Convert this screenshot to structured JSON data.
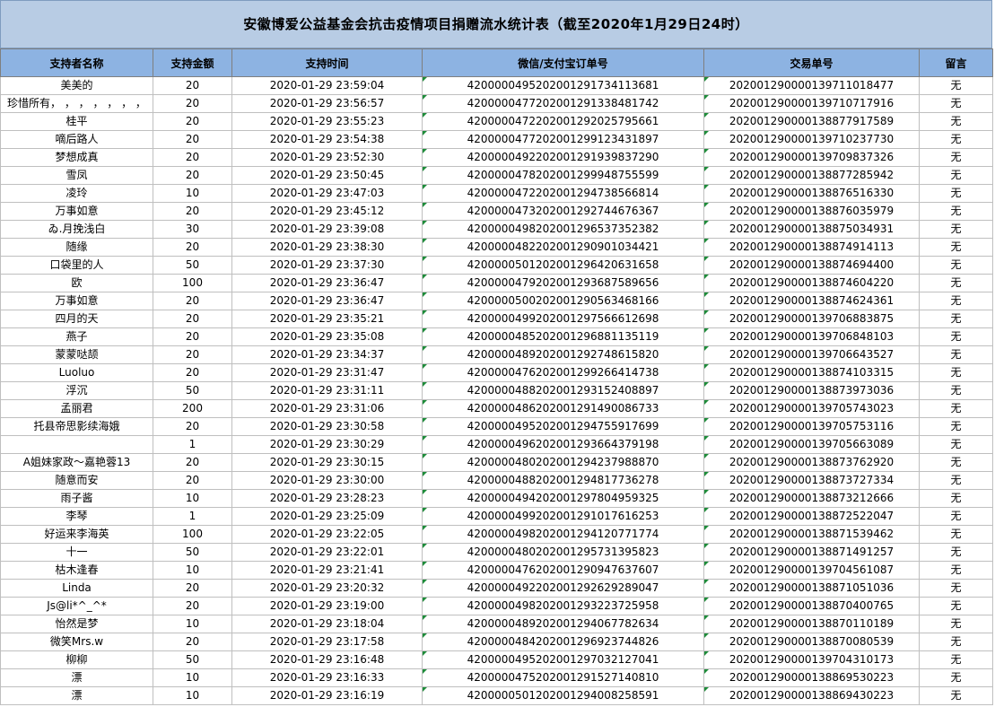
{
  "title": "安徽博爱公益基金会抗击疫情项目捐赠流水统计表（截至2020年1月29日24时）",
  "headers": [
    "支持者名称",
    "支持金额",
    "支持时间",
    "微信/支付宝订单号",
    "交易单号",
    "留言"
  ],
  "rows": [
    [
      "美美的",
      "20",
      "2020-01-29 23:59:04",
      "4200000495202001291734113681",
      "2020012900001397110184​77",
      "无"
    ],
    [
      "珍惜所有， ， ， ， ， ， ，",
      "20",
      "2020-01-29 23:56:57",
      "4200000477202001291338481742",
      "202001290000139710717916",
      "无"
    ],
    [
      "桂平",
      "20",
      "2020-01-29 23:55:23",
      "4200000472202001292025795661",
      "202001290000138877917589",
      "无"
    ],
    [
      "嘀后路人",
      "20",
      "2020-01-29 23:54:38",
      "4200000477202001299123431897",
      "202001290000139710237730",
      "无"
    ],
    [
      "梦想成真",
      "20",
      "2020-01-29 23:52:30",
      "4200000492202001291939837290",
      "202001290000139709837326",
      "无"
    ],
    [
      "雪凤",
      "20",
      "2020-01-29 23:50:45",
      "4200000478202001299948755599",
      "202001290000138877285942",
      "无"
    ],
    [
      "凌玲",
      "10",
      "2020-01-29 23:47:03",
      "4200000472202001294738566814",
      "202001290000138876516330",
      "无"
    ],
    [
      "万事如意",
      "20",
      "2020-01-29 23:45:12",
      "4200000473202001292744676367",
      "202001290000138876035979",
      "无"
    ],
    [
      "ゐ.月挽浅白",
      "30",
      "2020-01-29 23:39:08",
      "4200000498202001296537352382",
      "202001290000138875034931",
      "无"
    ],
    [
      "随缘",
      "20",
      "2020-01-29 23:38:30",
      "4200000482202001290901034421",
      "202001290000138874914113",
      "无"
    ],
    [
      "口袋里的人",
      "50",
      "2020-01-29 23:37:30",
      "4200000501202001296420631658",
      "202001290000138874694400",
      "无"
    ],
    [
      "欧",
      "100",
      "2020-01-29 23:36:47",
      "4200000479202001293687589656",
      "202001290000138874604220",
      "无"
    ],
    [
      "万事如意",
      "20",
      "2020-01-29 23:36:47",
      "4200000500202001290563468166",
      "202001290000138874624361",
      "无"
    ],
    [
      "四月的天",
      "20",
      "2020-01-29 23:35:21",
      "4200000499202001297566612698",
      "202001290000139706883875",
      "无"
    ],
    [
      "燕子",
      "20",
      "2020-01-29 23:35:08",
      "4200000485202001296881135119",
      "202001290000139706848103",
      "无"
    ],
    [
      "蒙蒙哒颉",
      "20",
      "2020-01-29 23:34:37",
      "4200000489202001292748615820",
      "202001290000139706643527",
      "无"
    ],
    [
      "Luoluo",
      "20",
      "2020-01-29 23:31:47",
      "4200000476202001299266414738",
      "202001290000138874103315",
      "无"
    ],
    [
      "浮沉",
      "50",
      "2020-01-29 23:31:11",
      "4200000488202001293152408897",
      "202001290000138873973036",
      "无"
    ],
    [
      "孟丽君",
      "200",
      "2020-01-29 23:31:06",
      "4200000486202001291490086733",
      "202001290000139705743023",
      "无"
    ],
    [
      "托县帝思影续海娥",
      "20",
      "2020-01-29 23:30:58",
      "4200000495202001294755917699",
      "202001290000139705753116",
      "无"
    ],
    [
      "",
      "1",
      "2020-01-29 23:30:29",
      "4200000496202001293664379198",
      "202001290000139705663089",
      "无"
    ],
    [
      "A姐妹家政～嘉艳蓉13",
      "20",
      "2020-01-29 23:30:15",
      "4200000480202001294237988870",
      "202001290000138873762920",
      "无"
    ],
    [
      "随意而安",
      "20",
      "2020-01-29 23:30:00",
      "4200000488202001294817736278",
      "202001290000138873727334",
      "无"
    ],
    [
      "雨子酱",
      "10",
      "2020-01-29 23:28:23",
      "4200000494202001297804959325",
      "202001290000138873212666",
      "无"
    ],
    [
      "李琴",
      "1",
      "2020-01-29 23:25:09",
      "4200000499202001291017616253",
      "202001290000138872522047",
      "无"
    ],
    [
      "好运来李海英",
      "100",
      "2020-01-29 23:22:05",
      "4200000498202001294120771774",
      "202001290000138871539462",
      "无"
    ],
    [
      "十一",
      "50",
      "2020-01-29 23:22:01",
      "4200000480202001295731395823",
      "202001290000138871491257",
      "无"
    ],
    [
      "枯木逢春",
      "10",
      "2020-01-29 23:21:41",
      "4200000476202001290947637607",
      "202001290000139704561087",
      "无"
    ],
    [
      "Linda",
      "20",
      "2020-01-29 23:20:32",
      "4200000492202001292629289047",
      "202001290000138871051036",
      "无"
    ],
    [
      "Js@li*^_^*",
      "20",
      "2020-01-29 23:19:00",
      "4200000498202001293223725958",
      "202001290000138870400765",
      "无"
    ],
    [
      "怡然是梦",
      "10",
      "2020-01-29 23:18:04",
      "4200000489202001294067782634",
      "202001290000138870110189",
      "无"
    ],
    [
      "微笑Mrs.w",
      "20",
      "2020-01-29 23:17:58",
      "4200000484202001296923744826",
      "202001290000138870080539",
      "无"
    ],
    [
      "柳柳",
      "50",
      "2020-01-29 23:16:48",
      "4200000495202001297032127041",
      "202001290000139704310173",
      "无"
    ],
    [
      "漂",
      "10",
      "2020-01-29 23:16:33",
      "4200000475202001291527140810",
      "202001290000138869530223",
      "无"
    ],
    [
      "漂",
      "10",
      "2020-01-29 23:16:19",
      "4200000501202001294008258591",
      "202001290000138869430223",
      "无"
    ]
  ]
}
